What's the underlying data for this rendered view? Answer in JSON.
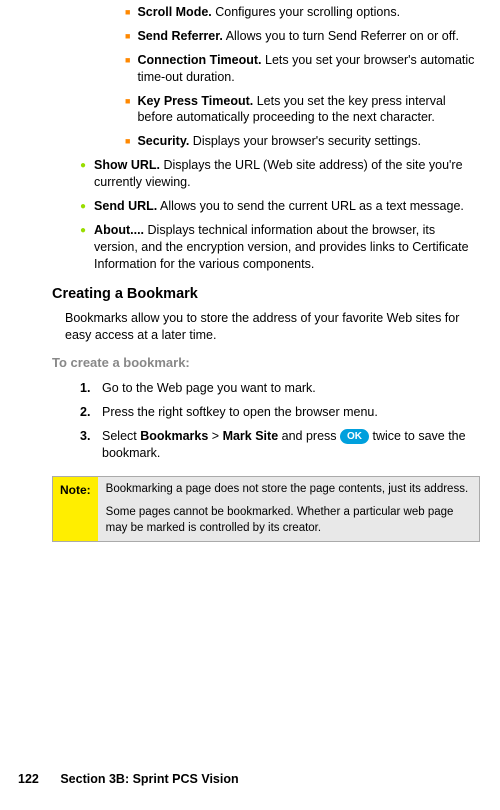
{
  "subitems": [
    {
      "title": "Scroll Mode.",
      "desc": " Configures your scrolling options."
    },
    {
      "title": "Send Referrer.",
      "desc": " Allows you to turn Send Referrer on or off."
    },
    {
      "title": "Connection Timeout.",
      "desc": " Lets you set your browser's automatic time-out duration."
    },
    {
      "title": "Key Press Timeout.",
      "desc": " Lets you set the key press interval before automatically proceeding to the next character."
    },
    {
      "title": "Security.",
      "desc": " Displays your browser's security settings."
    }
  ],
  "mainitems": [
    {
      "title": "Show URL.",
      "desc": " Displays the URL (Web site address) of the site you're currently viewing."
    },
    {
      "title": "Send URL.",
      "desc": " Allows you to send the current URL as a text message."
    },
    {
      "title": "About....",
      "desc": " Displays technical information about the browser, its version, and the encryption version, and provides links to Certificate Information for the various components."
    }
  ],
  "heading": "Creating a Bookmark",
  "intro": "Bookmarks allow you to store the address of your favorite Web sites for easy access at a later time.",
  "subhead": "To create a bookmark:",
  "steps": [
    {
      "num": "1.",
      "text": "Go to the Web page you want to mark."
    },
    {
      "num": "2.",
      "text": "Press the right softkey to open the browser menu."
    },
    {
      "num": "3.",
      "pre": "Select ",
      "b1": "Bookmarks",
      "mid": " > ",
      "b2": "Mark Site",
      "post1": " and press ",
      "ok": "OK",
      "post2": " twice to save the bookmark."
    }
  ],
  "note": {
    "label": "Note:",
    "p1": "Bookmarking a page does not store the page contents, just its address.",
    "p2": "Some pages cannot be bookmarked. Whether a particular web page may be marked is controlled by its creator."
  },
  "footer": {
    "page": "122",
    "section": "Section 3B: Sprint PCS Vision"
  }
}
